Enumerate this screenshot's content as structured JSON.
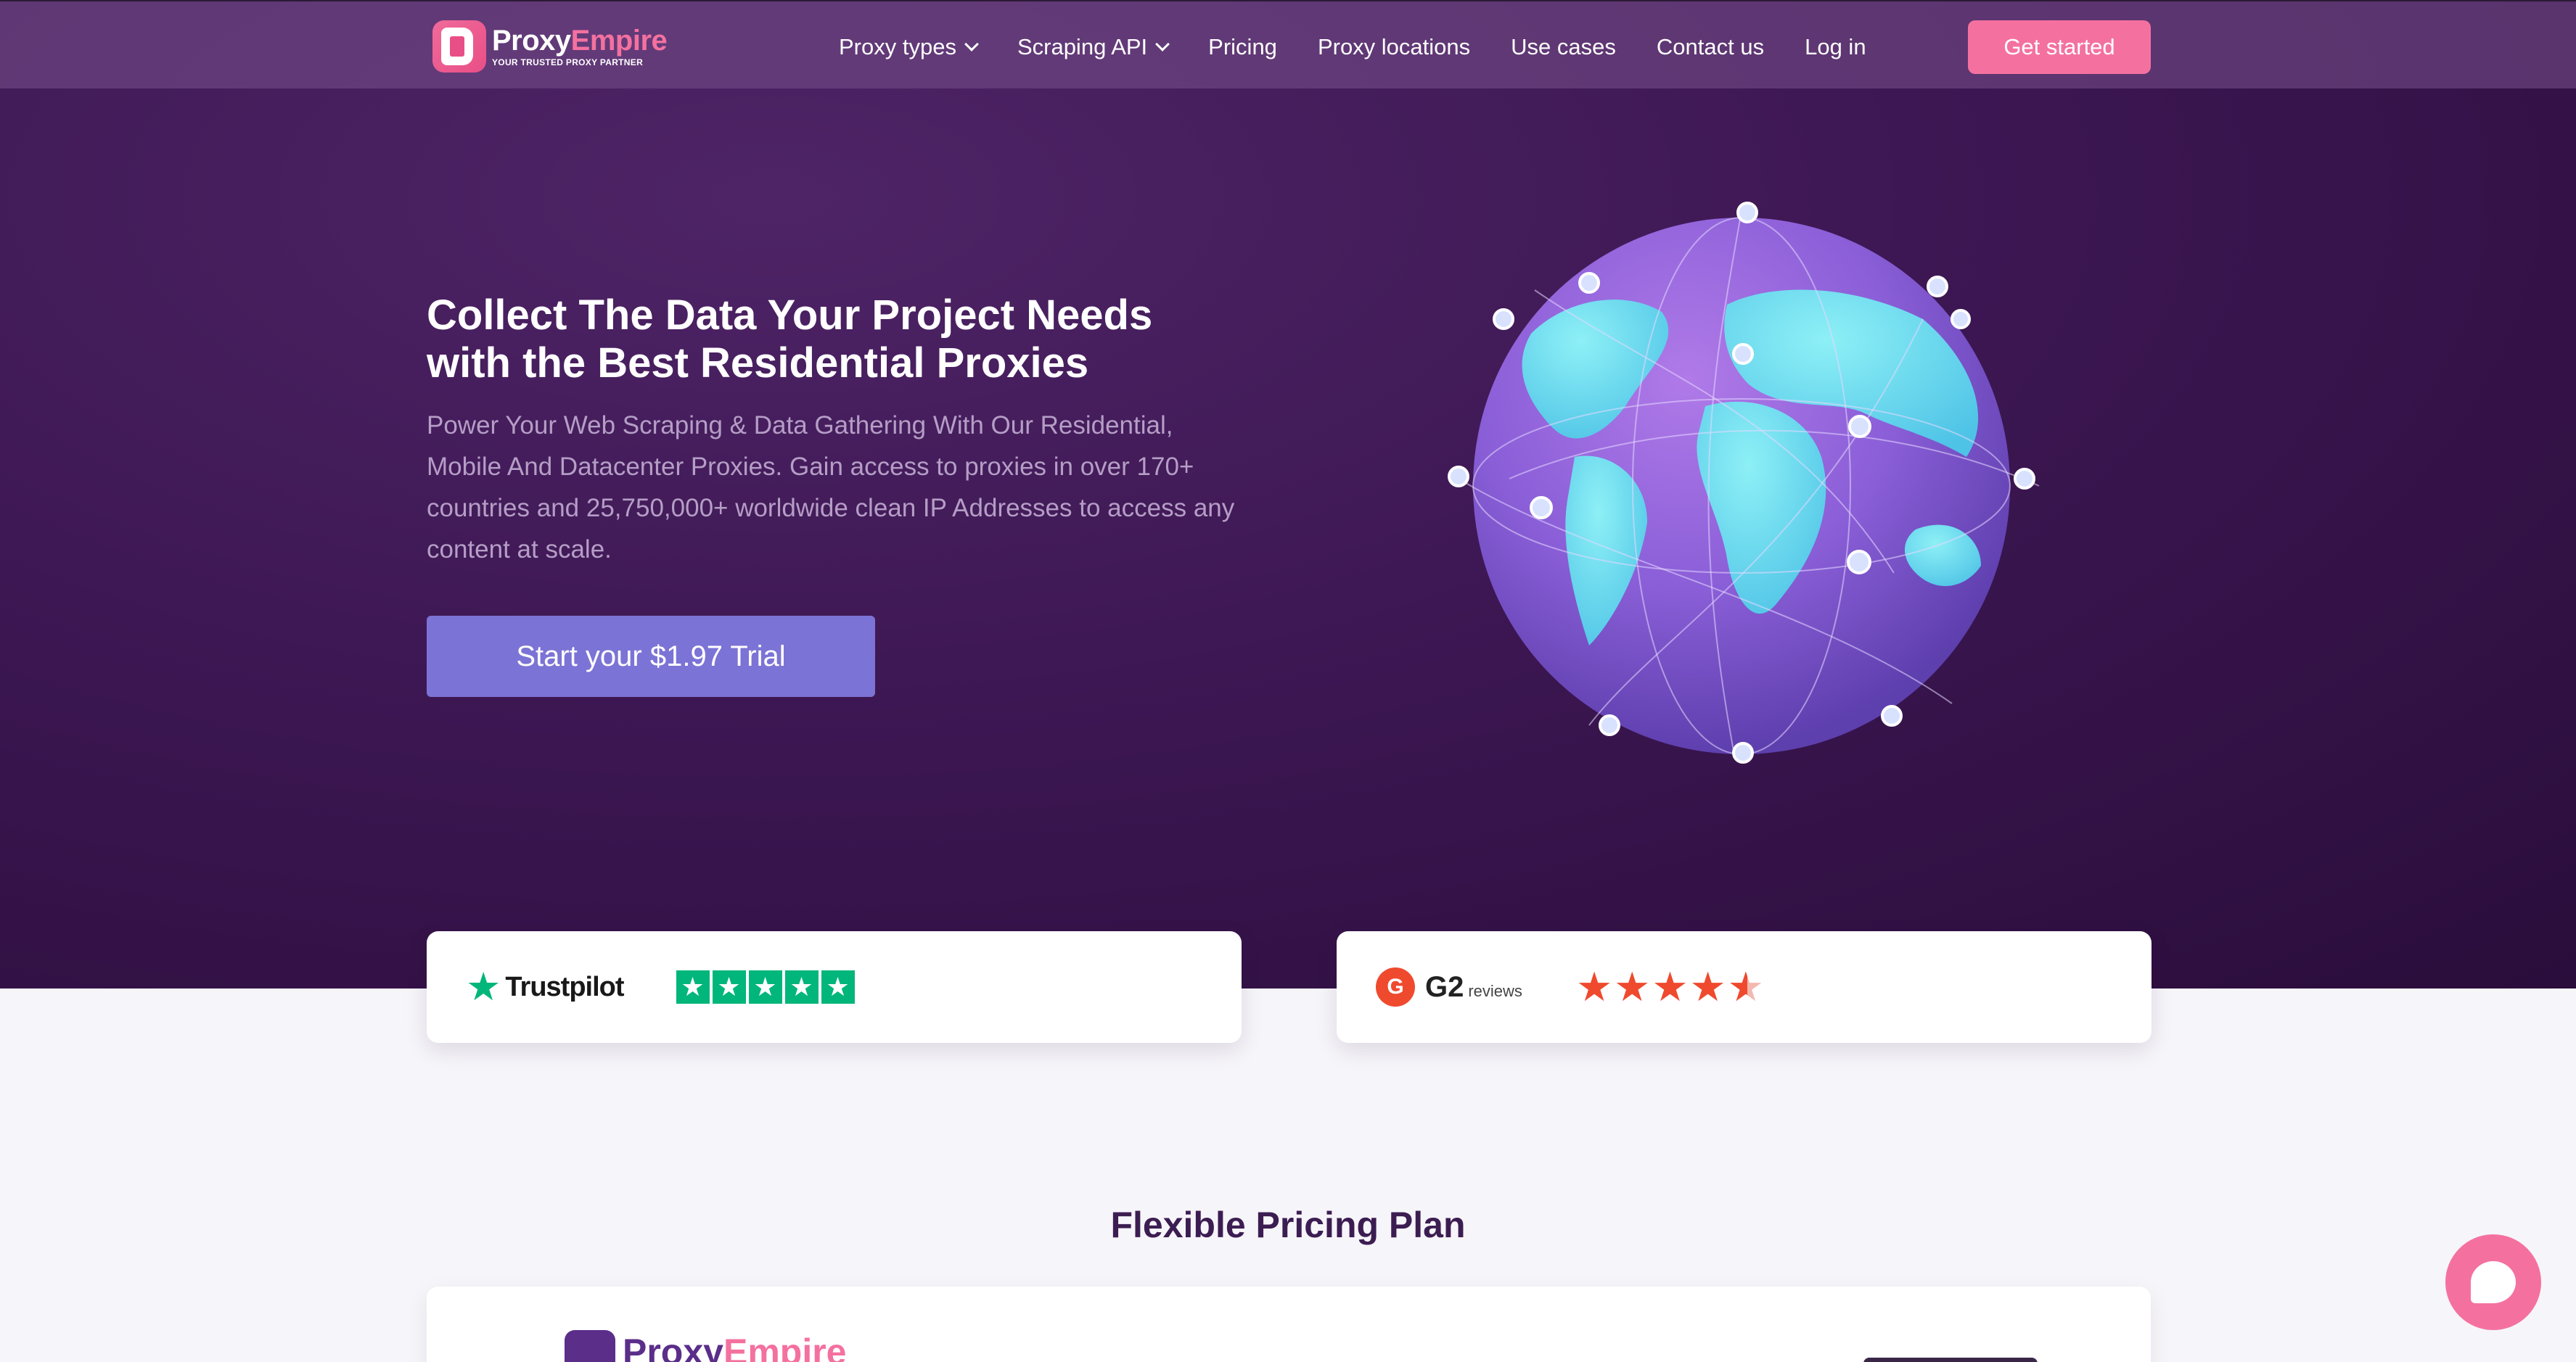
{
  "brand": {
    "name_part1": "Proxy",
    "name_part2": "Empire",
    "tagline": "YOUR TRUSTED PROXY PARTNER"
  },
  "nav": {
    "items": [
      {
        "label": "Proxy types",
        "dropdown": true
      },
      {
        "label": "Scraping API",
        "dropdown": true
      },
      {
        "label": "Pricing",
        "dropdown": false
      },
      {
        "label": "Proxy locations",
        "dropdown": false
      },
      {
        "label": "Use cases",
        "dropdown": false
      },
      {
        "label": "Contact us",
        "dropdown": false
      },
      {
        "label": "Log in",
        "dropdown": false
      }
    ],
    "cta": "Get started"
  },
  "hero": {
    "title_line1": "Collect The Data Your Project Needs",
    "title_line2": "with the Best Residential Proxies",
    "subtitle": "Power Your Web Scraping & Data Gathering With Our Residential, Mobile And Datacenter Proxies. Gain access to proxies in over 170+ countries and 25,750,000+ worldwide clean IP Addresses to access any content at scale.",
    "trial_button": "Start your $1.97 Trial"
  },
  "reviews": {
    "trustpilot": {
      "name": "Trustpilot",
      "stars": 5
    },
    "g2": {
      "name": "G2",
      "suffix": "reviews",
      "badge": "G",
      "stars": 4.5
    }
  },
  "pricing": {
    "title": "Flexible Pricing Plan",
    "card_logo_part1": "Proxy",
    "card_logo_part2": "Empire"
  },
  "colors": {
    "accent": "#f4719f",
    "trial": "#7c73d6",
    "trustpilot": "#00b67a",
    "g2": "#ef4a2e",
    "hero_bg": "#3d1753"
  },
  "icons": {
    "chat": "chat-bubble-icon",
    "dropdown": "chevron-down-icon",
    "globe": "globe-network-illustration"
  }
}
